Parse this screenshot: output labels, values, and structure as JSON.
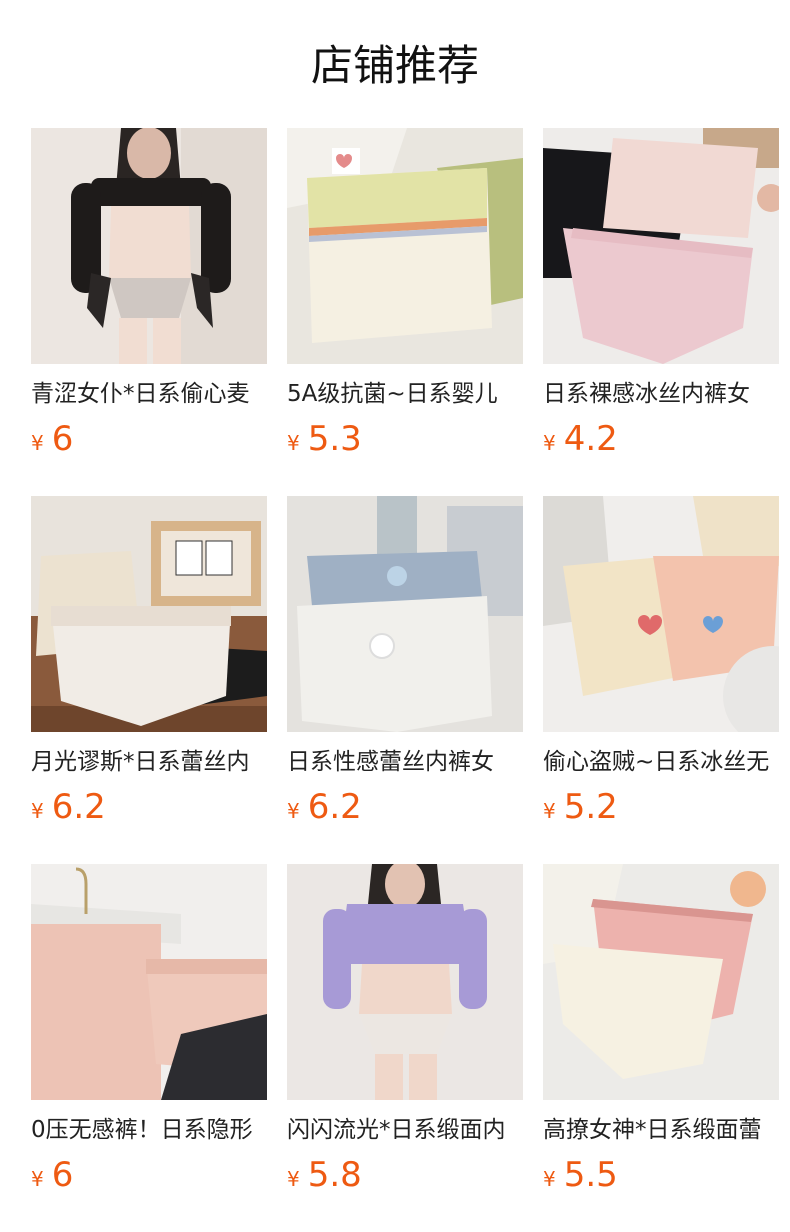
{
  "header": {
    "title": "店铺推荐"
  },
  "currency_symbol": "¥",
  "products": [
    {
      "name": "青涩女仆*日系偷心麦",
      "price": "6",
      "thumb": "maid-set-photo"
    },
    {
      "name": "5A级抗菌~日系婴儿",
      "price": "5.3",
      "thumb": "cream-brief-photo"
    },
    {
      "name": "日系裸感冰丝内裤女",
      "price": "4.2",
      "thumb": "pink-black-brief-photo"
    },
    {
      "name": "月光谬斯*日系蕾丝内",
      "price": "6.2",
      "thumb": "white-lace-brief-photo"
    },
    {
      "name": "日系性感蕾丝内裤女",
      "price": "6.2",
      "thumb": "blue-bow-brief-photo"
    },
    {
      "name": "偷心盗贼~日系冰丝无",
      "price": "5.2",
      "thumb": "heart-brief-photo"
    },
    {
      "name": "0压无感裤！日系隐形",
      "price": "6",
      "thumb": "pink-hanger-photo"
    },
    {
      "name": "闪闪流光*日系缎面内",
      "price": "5.8",
      "thumb": "lilac-cardigan-photo"
    },
    {
      "name": "高撩女神*日系缎面蕾",
      "price": "5.5",
      "thumb": "pink-string-photo"
    }
  ]
}
